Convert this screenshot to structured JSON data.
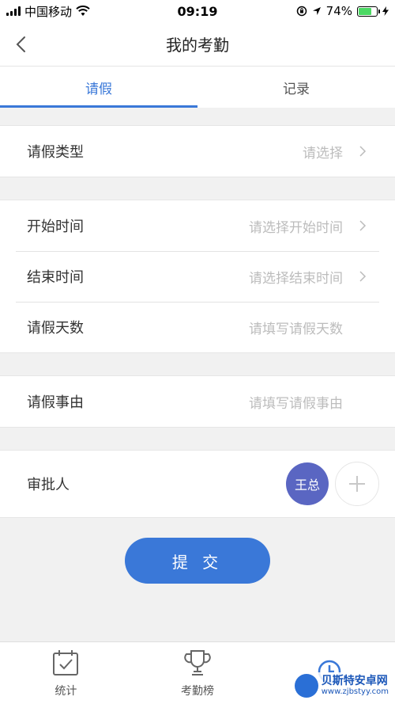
{
  "status_bar": {
    "carrier": "中国移动",
    "time": "09:19",
    "battery_percent": "74%",
    "battery_level": 0.74,
    "icons": [
      "signal-icon",
      "wifi-icon",
      "lock-rotation-icon",
      "location-icon",
      "battery-icon",
      "charging-icon"
    ]
  },
  "nav": {
    "title": "我的考勤",
    "back_icon": "chevron-left-icon"
  },
  "tabs": [
    {
      "label": "请假",
      "active": true
    },
    {
      "label": "记录",
      "active": false
    }
  ],
  "form": {
    "leave_type": {
      "label": "请假类型",
      "placeholder": "请选择"
    },
    "start_time": {
      "label": "开始时间",
      "placeholder": "请选择开始时间"
    },
    "end_time": {
      "label": "结束时间",
      "placeholder": "请选择结束时间"
    },
    "days": {
      "label": "请假天数",
      "placeholder": "请填写请假天数"
    },
    "reason": {
      "label": "请假事由",
      "placeholder": "请填写请假事由"
    },
    "approver": {
      "label": "审批人",
      "name": "王总"
    }
  },
  "submit_label": "提 交",
  "bottom_nav": [
    {
      "label": "统计",
      "icon": "calendar-check-icon"
    },
    {
      "label": "考勤榜",
      "icon": "trophy-icon"
    },
    {
      "label": "",
      "icon": "clock-icon"
    }
  ],
  "watermark": {
    "title": "贝斯特安卓网",
    "url": "www.zjbstyy.com"
  },
  "colors": {
    "accent": "#3a78d8",
    "avatar": "#5a66c2",
    "placeholder": "#bcbcbc",
    "background": "#f1f1f1"
  }
}
